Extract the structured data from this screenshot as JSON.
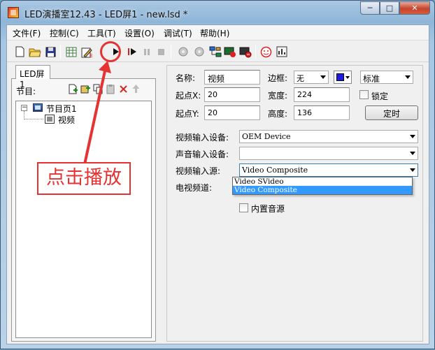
{
  "window": {
    "title": "LED演播室12.43 - LED屏1 - new.lsd *",
    "controls": [
      "─",
      "□",
      "✕"
    ]
  },
  "menu": [
    "文件(F)",
    "控制(C)",
    "工具(T)",
    "设置(O)",
    "调试(T)",
    "帮助(H)"
  ],
  "toolbar": {
    "icons": [
      "new-file-icon",
      "open-folder-icon",
      "save-icon",
      "grid-icon",
      "edit-script-icon",
      "play-icon",
      "play-step-icon",
      "pause-icon",
      "stop-icon",
      "gear-left-icon",
      "gear-right-icon",
      "network-icon",
      "monitor-red-icon",
      "monitor-stop-icon",
      "smiley-icon",
      "chart-icon"
    ],
    "highlighted": "play-icon"
  },
  "left_panel": {
    "tab_label": "LED屏1",
    "program_label": "节目:",
    "tree": {
      "page_label": "节目页1",
      "expander": "−",
      "child_label": "视频"
    }
  },
  "properties": {
    "name_label": "名称:",
    "name_value": "视频",
    "border_label": "边框:",
    "border_value": "无",
    "border_color": "#1f1ae0",
    "style_value": "标准",
    "startx_label": "起点X:",
    "startx_value": "20",
    "width_label": "宽度:",
    "width_value": "224",
    "lock_label": "锁定",
    "starty_label": "起点Y:",
    "starty_value": "20",
    "height_label": "高度:",
    "height_value": "136",
    "timer_button": "定时",
    "video_device_label": "视频输入设备:",
    "video_device_value": "OEM Device",
    "audio_device_label": "声音输入设备:",
    "audio_device_value": "",
    "video_source_label": "视频输入源:",
    "video_source_value": "Video Composite",
    "tv_channel_label": "电视频道:",
    "builtin_audio_label": "内置音源",
    "source_options": [
      "Video SVideo",
      "Video Composite"
    ],
    "selected_option": "Video Composite"
  },
  "annotation": {
    "text": "点击播放",
    "color": "#e53232"
  }
}
